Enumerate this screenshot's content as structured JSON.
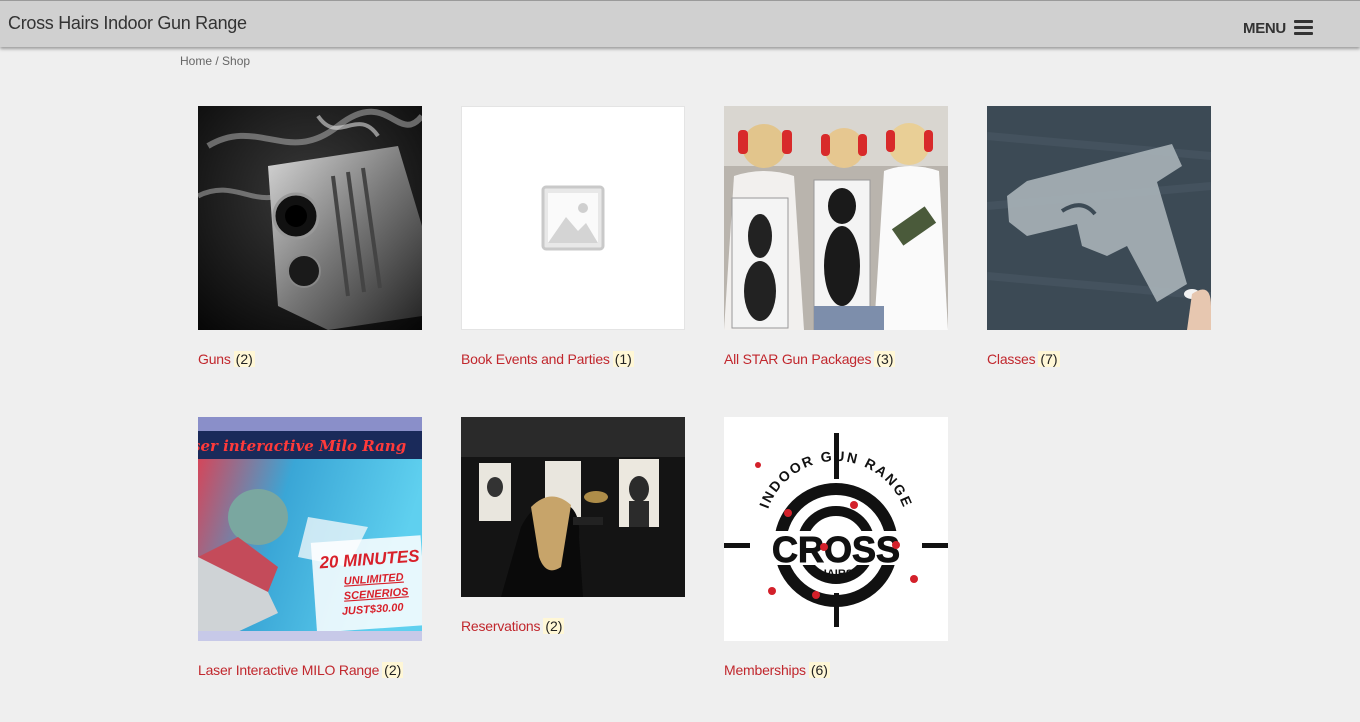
{
  "header": {
    "site_title": "Cross Hairs Indoor Gun Range",
    "menu_label": "MENU"
  },
  "breadcrumb": {
    "home": "Home",
    "separator": " / ",
    "current": "Shop"
  },
  "categories": [
    {
      "name": "Guns",
      "count": "(2)",
      "image": "handgun-smoke-photo"
    },
    {
      "name": "Book Events and Parties",
      "count": "(1)",
      "image": "placeholder-image"
    },
    {
      "name": "All STAR Gun Packages",
      "count": "(3)",
      "image": "women-with-targets-photo"
    },
    {
      "name": "Classes",
      "count": "(7)",
      "image": "chalk-pistol-drawing"
    },
    {
      "name": "Laser Interactive MILO Range",
      "count": "(2)",
      "image": "milo-range-promo",
      "image_text": {
        "banner": "ser interactive Milo Rang",
        "line1": "20 MINUTES",
        "line2": "UNLIMITED",
        "line3": "SCENERIOS",
        "line4": "JUST$30.00"
      }
    },
    {
      "name": "Reservations",
      "count": "(2)",
      "image": "shooter-at-range-photo"
    },
    {
      "name": "Memberships",
      "count": "(6)",
      "image": "cross-hairs-logo",
      "image_text": {
        "arc": "INDOOR GUN RANGE",
        "big": "CROSS",
        "small": "HAIRS"
      }
    }
  ],
  "colors": {
    "link": "#c1272d",
    "background": "#efefef",
    "header": "#d0d0d0"
  }
}
